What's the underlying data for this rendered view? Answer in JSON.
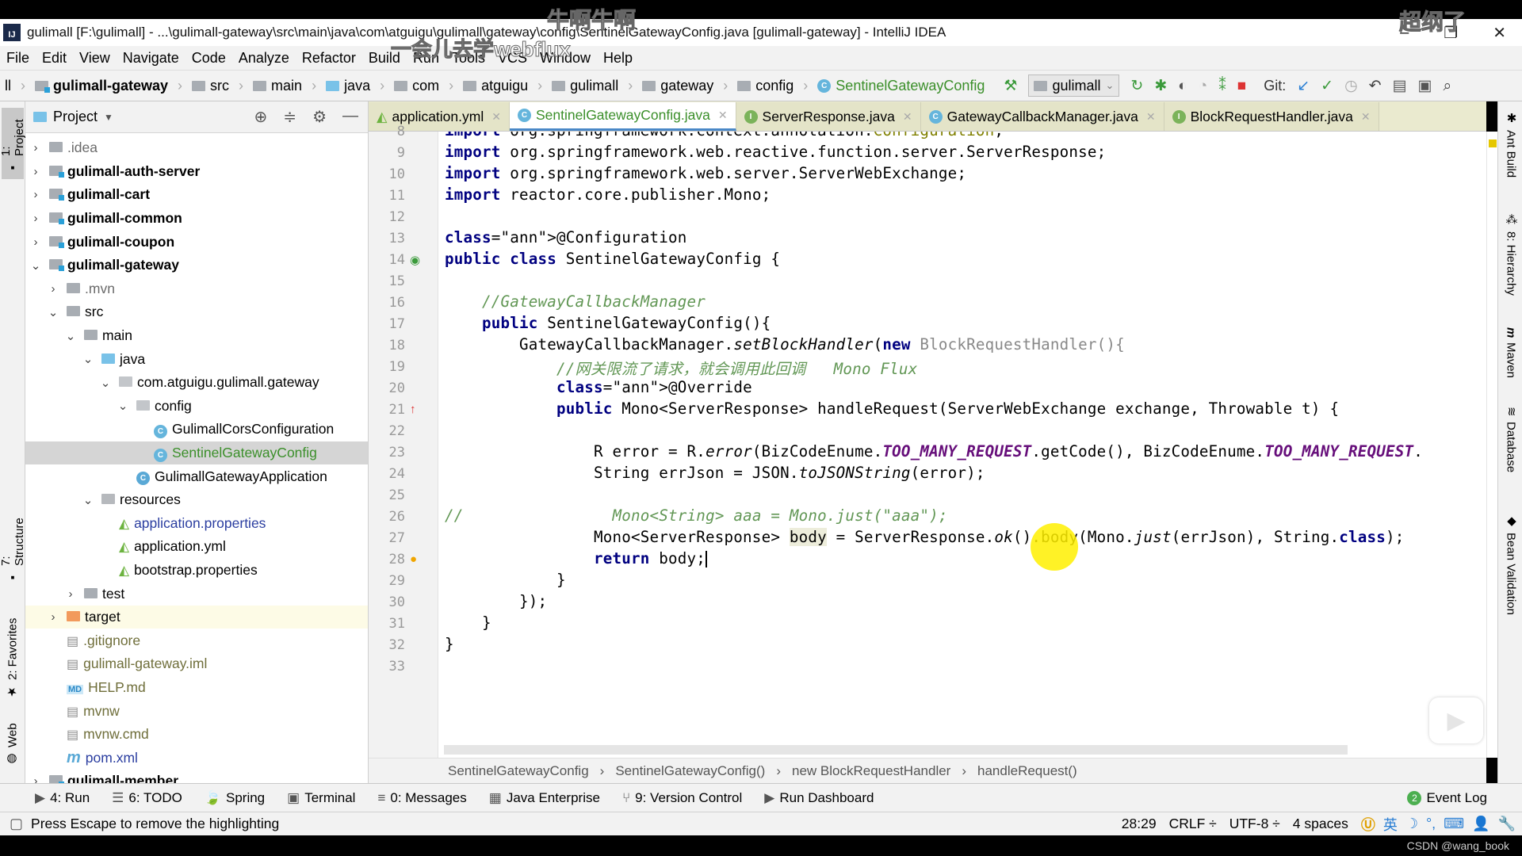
{
  "window": {
    "title": "gulimall [F:\\gulimall] - ...\\gulimall-gateway\\src\\main\\java\\com\\atguigu\\gulimall\\gateway\\config\\SentinelGatewayConfig.java [gulimall-gateway] - IntelliJ IDEA",
    "minimize": "–",
    "maximize": "❐",
    "close": "✕"
  },
  "overlays": {
    "top_center": "牛啊牛啊",
    "top_right": "超纲了",
    "subtitle": "一会儿去学webflux",
    "watermark": "CSDN @wang_book"
  },
  "menu": [
    "File",
    "Edit",
    "View",
    "Navigate",
    "Code",
    "Analyze",
    "Refactor",
    "Build",
    "Run",
    "Tools",
    "VCS",
    "Window",
    "Help"
  ],
  "breadcrumbs": [
    "ll",
    "gulimall-gateway",
    "src",
    "main",
    "java",
    "com",
    "atguigu",
    "gulimall",
    "gateway",
    "config",
    "SentinelGatewayConfig"
  ],
  "toolbar": {
    "run_config": "gulimall",
    "git_label": "Git:"
  },
  "left_tool_tabs": [
    "1: Project",
    "7: Structure",
    "2: Favorites",
    "Web"
  ],
  "right_tool_tabs": [
    "Ant Build",
    "8: Hierarchy",
    "Maven",
    "Database",
    "Bean Validation"
  ],
  "project": {
    "header": "Project",
    "tree": [
      {
        "label": ".idea",
        "depth": 0,
        "arrow": "›",
        "icon": "folder",
        "style": "gray"
      },
      {
        "label": "gulimall-auth-server",
        "depth": 0,
        "arrow": "›",
        "icon": "module",
        "style": "bold"
      },
      {
        "label": "gulimall-cart",
        "depth": 0,
        "arrow": "›",
        "icon": "module",
        "style": "bold"
      },
      {
        "label": "gulimall-common",
        "depth": 0,
        "arrow": "›",
        "icon": "module",
        "style": "bold"
      },
      {
        "label": "gulimall-coupon",
        "depth": 0,
        "arrow": "›",
        "icon": "module",
        "style": "bold"
      },
      {
        "label": "gulimall-gateway",
        "depth": 0,
        "arrow": "⌄",
        "icon": "module",
        "style": "bold"
      },
      {
        "label": ".mvn",
        "depth": 1,
        "arrow": "›",
        "icon": "folder",
        "style": "gray"
      },
      {
        "label": "src",
        "depth": 1,
        "arrow": "⌄",
        "icon": "folder",
        "style": ""
      },
      {
        "label": "main",
        "depth": 2,
        "arrow": "⌄",
        "icon": "folder",
        "style": ""
      },
      {
        "label": "java",
        "depth": 3,
        "arrow": "⌄",
        "icon": "folder-blue",
        "style": ""
      },
      {
        "label": "com.atguigu.gulimall.gateway",
        "depth": 4,
        "arrow": "⌄",
        "icon": "package",
        "style": ""
      },
      {
        "label": "config",
        "depth": 5,
        "arrow": "⌄",
        "icon": "package",
        "style": ""
      },
      {
        "label": "GulimallCorsConfiguration",
        "depth": 6,
        "arrow": "",
        "icon": "class",
        "style": ""
      },
      {
        "label": "SentinelGatewayConfig",
        "depth": 6,
        "arrow": "",
        "icon": "class",
        "style": "green",
        "selected": true
      },
      {
        "label": "GulimallGatewayApplication",
        "depth": 5,
        "arrow": "",
        "icon": "spring-class",
        "style": ""
      },
      {
        "label": "resources",
        "depth": 3,
        "arrow": "⌄",
        "icon": "resources",
        "style": ""
      },
      {
        "label": "application.properties",
        "depth": 4,
        "arrow": "",
        "icon": "spring-config",
        "style": "blue"
      },
      {
        "label": "application.yml",
        "depth": 4,
        "arrow": "",
        "icon": "spring-config",
        "style": ""
      },
      {
        "label": "bootstrap.properties",
        "depth": 4,
        "arrow": "",
        "icon": "spring-config",
        "style": ""
      },
      {
        "label": "test",
        "depth": 2,
        "arrow": "›",
        "icon": "folder",
        "style": ""
      },
      {
        "label": "target",
        "depth": 1,
        "arrow": "›",
        "icon": "folder-orange",
        "style": "",
        "target": true
      },
      {
        "label": ".gitignore",
        "depth": 1,
        "arrow": "",
        "icon": "file",
        "style": "olive"
      },
      {
        "label": "gulimall-gateway.iml",
        "depth": 1,
        "arrow": "",
        "icon": "file",
        "style": "olive"
      },
      {
        "label": "HELP.md",
        "depth": 1,
        "arrow": "",
        "icon": "md",
        "style": "olive"
      },
      {
        "label": "mvnw",
        "depth": 1,
        "arrow": "",
        "icon": "file",
        "style": "olive"
      },
      {
        "label": "mvnw.cmd",
        "depth": 1,
        "arrow": "",
        "icon": "file",
        "style": "olive"
      },
      {
        "label": "pom.xml",
        "depth": 1,
        "arrow": "",
        "icon": "maven",
        "style": "blue"
      },
      {
        "label": "gulimall-member",
        "depth": 0,
        "arrow": "›",
        "icon": "module",
        "style": "bold"
      }
    ]
  },
  "editor_tabs": [
    {
      "label": "application.yml",
      "icon": "spring-config",
      "active": false
    },
    {
      "label": "SentinelGatewayConfig.java",
      "icon": "class",
      "active": true
    },
    {
      "label": "ServerResponse.java",
      "icon": "interface",
      "active": false
    },
    {
      "label": "GatewayCallbackManager.java",
      "icon": "class",
      "active": false
    },
    {
      "label": "BlockRequestHandler.java",
      "icon": "interface",
      "active": false
    }
  ],
  "code": {
    "first_line": 8,
    "lines": [
      "import org.springframework.context.annotation.Configuration;",
      "import org.springframework.web.reactive.function.server.ServerResponse;",
      "import org.springframework.web.server.ServerWebExchange;",
      "import reactor.core.publisher.Mono;",
      "",
      "@Configuration",
      "public class SentinelGatewayConfig {",
      "",
      "    //GatewayCallbackManager",
      "    public SentinelGatewayConfig(){",
      "        GatewayCallbackManager.setBlockHandler(new BlockRequestHandler(){",
      "            //网关限流了请求，就会调用此回调   Mono Flux",
      "            @Override",
      "            public Mono<ServerResponse> handleRequest(ServerWebExchange exchange, Throwable t) {",
      "",
      "                R error = R.error(BizCodeEnume.TOO_MANY_REQUEST.getCode(), BizCodeEnume.TOO_MANY_REQUEST.",
      "                String errJson = JSON.toJSONString(error);",
      "",
      "//                Mono<String> aaa = Mono.just(\"aaa\");",
      "                Mono<ServerResponse> body = ServerResponse.ok().body(Mono.just(errJson), String.class);",
      "                return body;",
      "            }",
      "        });",
      "    }",
      "}",
      ""
    ],
    "current_line": 28
  },
  "editor_breadcrumbs": [
    "SentinelGatewayConfig",
    "SentinelGatewayConfig()",
    "new BlockRequestHandler",
    "handleRequest()"
  ],
  "tool_windows": [
    {
      "label": "4: Run",
      "icon": "▶"
    },
    {
      "label": "6: TODO",
      "icon": "☰"
    },
    {
      "label": "Spring",
      "icon": "🍃"
    },
    {
      "label": "Terminal",
      "icon": "▣"
    },
    {
      "label": "0: Messages",
      "icon": "≡"
    },
    {
      "label": "Java Enterprise",
      "icon": "▦"
    },
    {
      "label": "9: Version Control",
      "icon": "⑂"
    },
    {
      "label": "Run Dashboard",
      "icon": "▶"
    }
  ],
  "event_log": {
    "label": "Event Log",
    "count": "2"
  },
  "status": {
    "message": "Press Escape to remove the highlighting",
    "position": "28:29",
    "line_sep": "CRLF ÷",
    "encoding": "UTF-8 ÷",
    "indent": "4 spaces",
    "ime": "英"
  }
}
